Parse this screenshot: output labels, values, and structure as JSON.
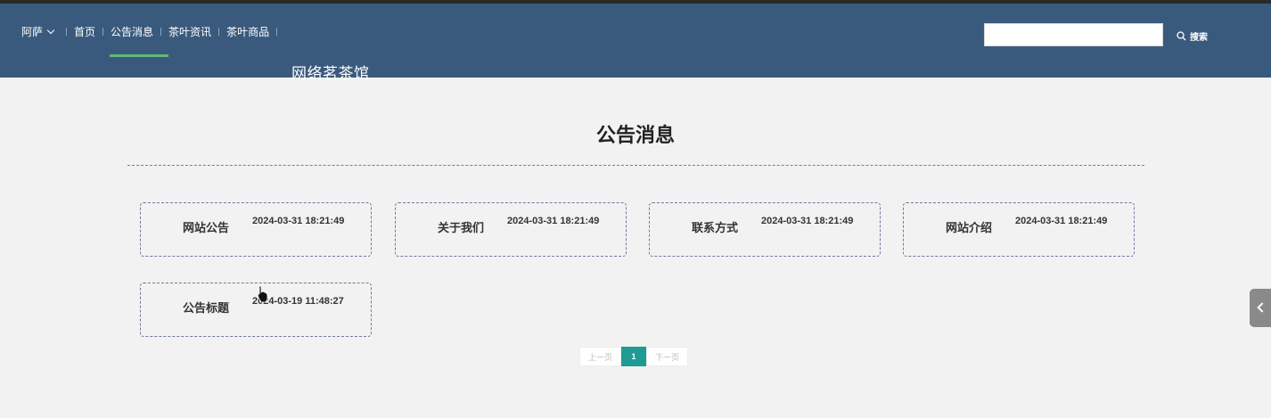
{
  "header": {
    "user_label": "阿萨",
    "nav": [
      "首页",
      "公告消息",
      "茶叶资讯",
      "茶叶商品"
    ],
    "brand": "网络茗茶馆",
    "search_value": "",
    "search_label": "搜索"
  },
  "main": {
    "page_title": "公告消息",
    "cards": [
      {
        "title": "网站公告",
        "date": "2024-03-31 18:21:49"
      },
      {
        "title": "关于我们",
        "date": "2024-03-31 18:21:49"
      },
      {
        "title": "联系方式",
        "date": "2024-03-31 18:21:49"
      },
      {
        "title": "网站介绍",
        "date": "2024-03-31 18:21:49"
      },
      {
        "title": "公告标题",
        "date": "2024-03-19 11:48:27"
      }
    ],
    "pager": {
      "prev": "上一页",
      "current": "1",
      "next": "下一页"
    }
  },
  "colors": {
    "header_bg": "#3a5a7d",
    "active_underline": "#5fb878",
    "divider": "#2f9ea6",
    "pager_active": "#1e9b94"
  },
  "icons": [
    "chevron-down-icon",
    "search-icon",
    "chevron-left-icon"
  ]
}
